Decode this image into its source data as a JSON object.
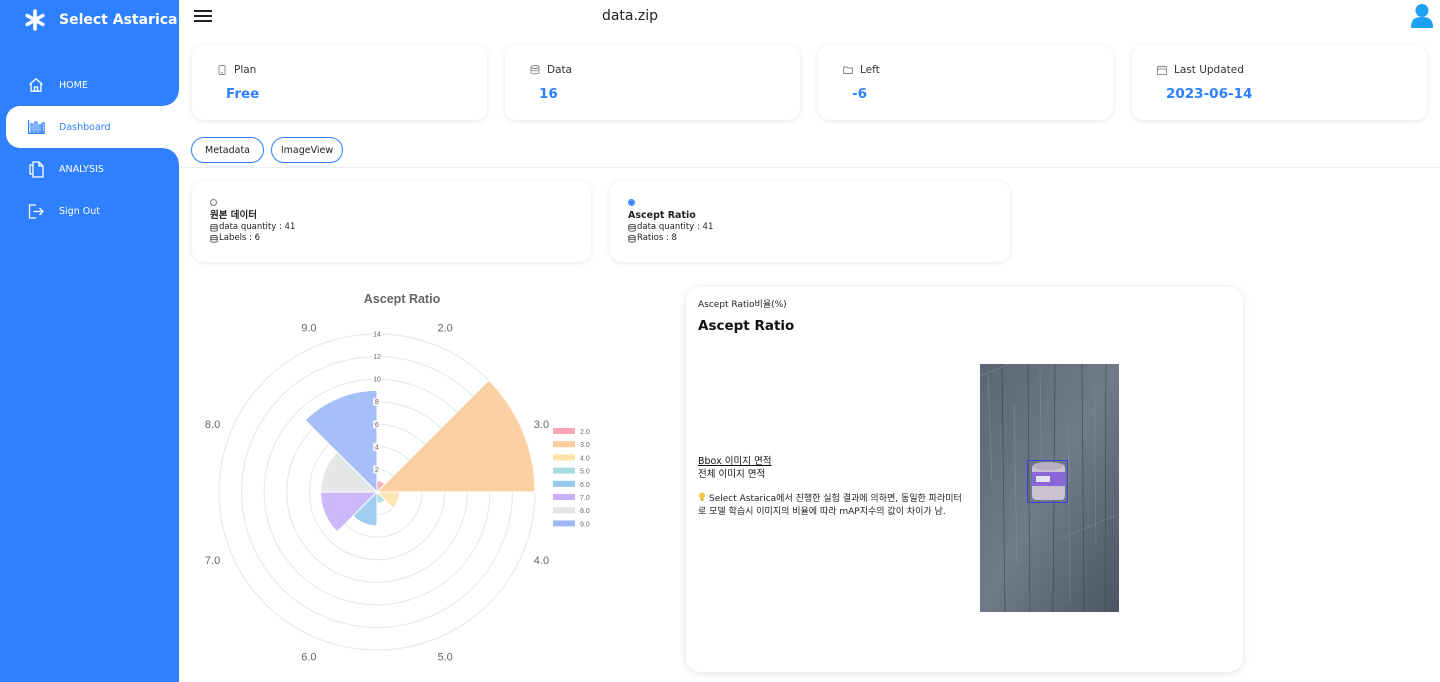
{
  "app": {
    "name": "Select Astarica",
    "file_title": "data.zip"
  },
  "sidebar": {
    "items": [
      {
        "label": "HOME",
        "icon": "home-icon"
      },
      {
        "label": "Dashboard",
        "icon": "bar-chart-icon",
        "active": true
      },
      {
        "label": "ANALYSIS",
        "icon": "document-copy-icon"
      },
      {
        "label": "Sign Out",
        "icon": "sign-out-icon"
      }
    ]
  },
  "stats": [
    {
      "label": "Plan",
      "value": "Free",
      "icon": "phone-icon"
    },
    {
      "label": "Data",
      "value": "16",
      "icon": "database-icon"
    },
    {
      "label": "Left",
      "value": "-6",
      "icon": "folder-icon"
    },
    {
      "label": "Last Updated",
      "value": "2023-06-14",
      "icon": "calendar-icon"
    }
  ],
  "tabs": {
    "metadata": "Metadata",
    "imageview": "ImageView"
  },
  "options": {
    "original": {
      "title": "원본 데이터",
      "quantity": "data quantity : 41",
      "extra": "Labels : 6",
      "selected": false
    },
    "ratio": {
      "title": "Ascept Ratio",
      "quantity": "data quantity : 41",
      "extra": "Ratios : 8",
      "selected": true
    }
  },
  "chart_data": {
    "type": "polar-area",
    "title": "Ascept Ratio",
    "categories": [
      "2.0",
      "3.0",
      "4.0",
      "5.0",
      "6.0",
      "7.0",
      "8.0",
      "9.0"
    ],
    "values": [
      1,
      14,
      2,
      1,
      3,
      5,
      5,
      9
    ],
    "colors": [
      "#f8a5b6",
      "#fdcb9a",
      "#fde3a7",
      "#a8dde0",
      "#96c8ee",
      "#c8b0f8",
      "#e3e4e6",
      "#9cb8f8"
    ],
    "r_ticks": [
      "2",
      "4",
      "6",
      "8",
      "10",
      "12",
      "14"
    ],
    "rlim": [
      0,
      14
    ],
    "legend": "right",
    "grid": true
  },
  "ratio_panel": {
    "caption": "Ascept Ratio비율(%)",
    "title": "Ascept Ratio",
    "numerator": "Bbox 이미지 면적",
    "denominator": "전체 이미지 면적",
    "note": "Select Astarica에서 진행한 실험 결과에 의하면, 동일한 파라미터로 모델 학습시 이미지의 비율에 따라 mAP지수의 값이 차이가 남."
  }
}
